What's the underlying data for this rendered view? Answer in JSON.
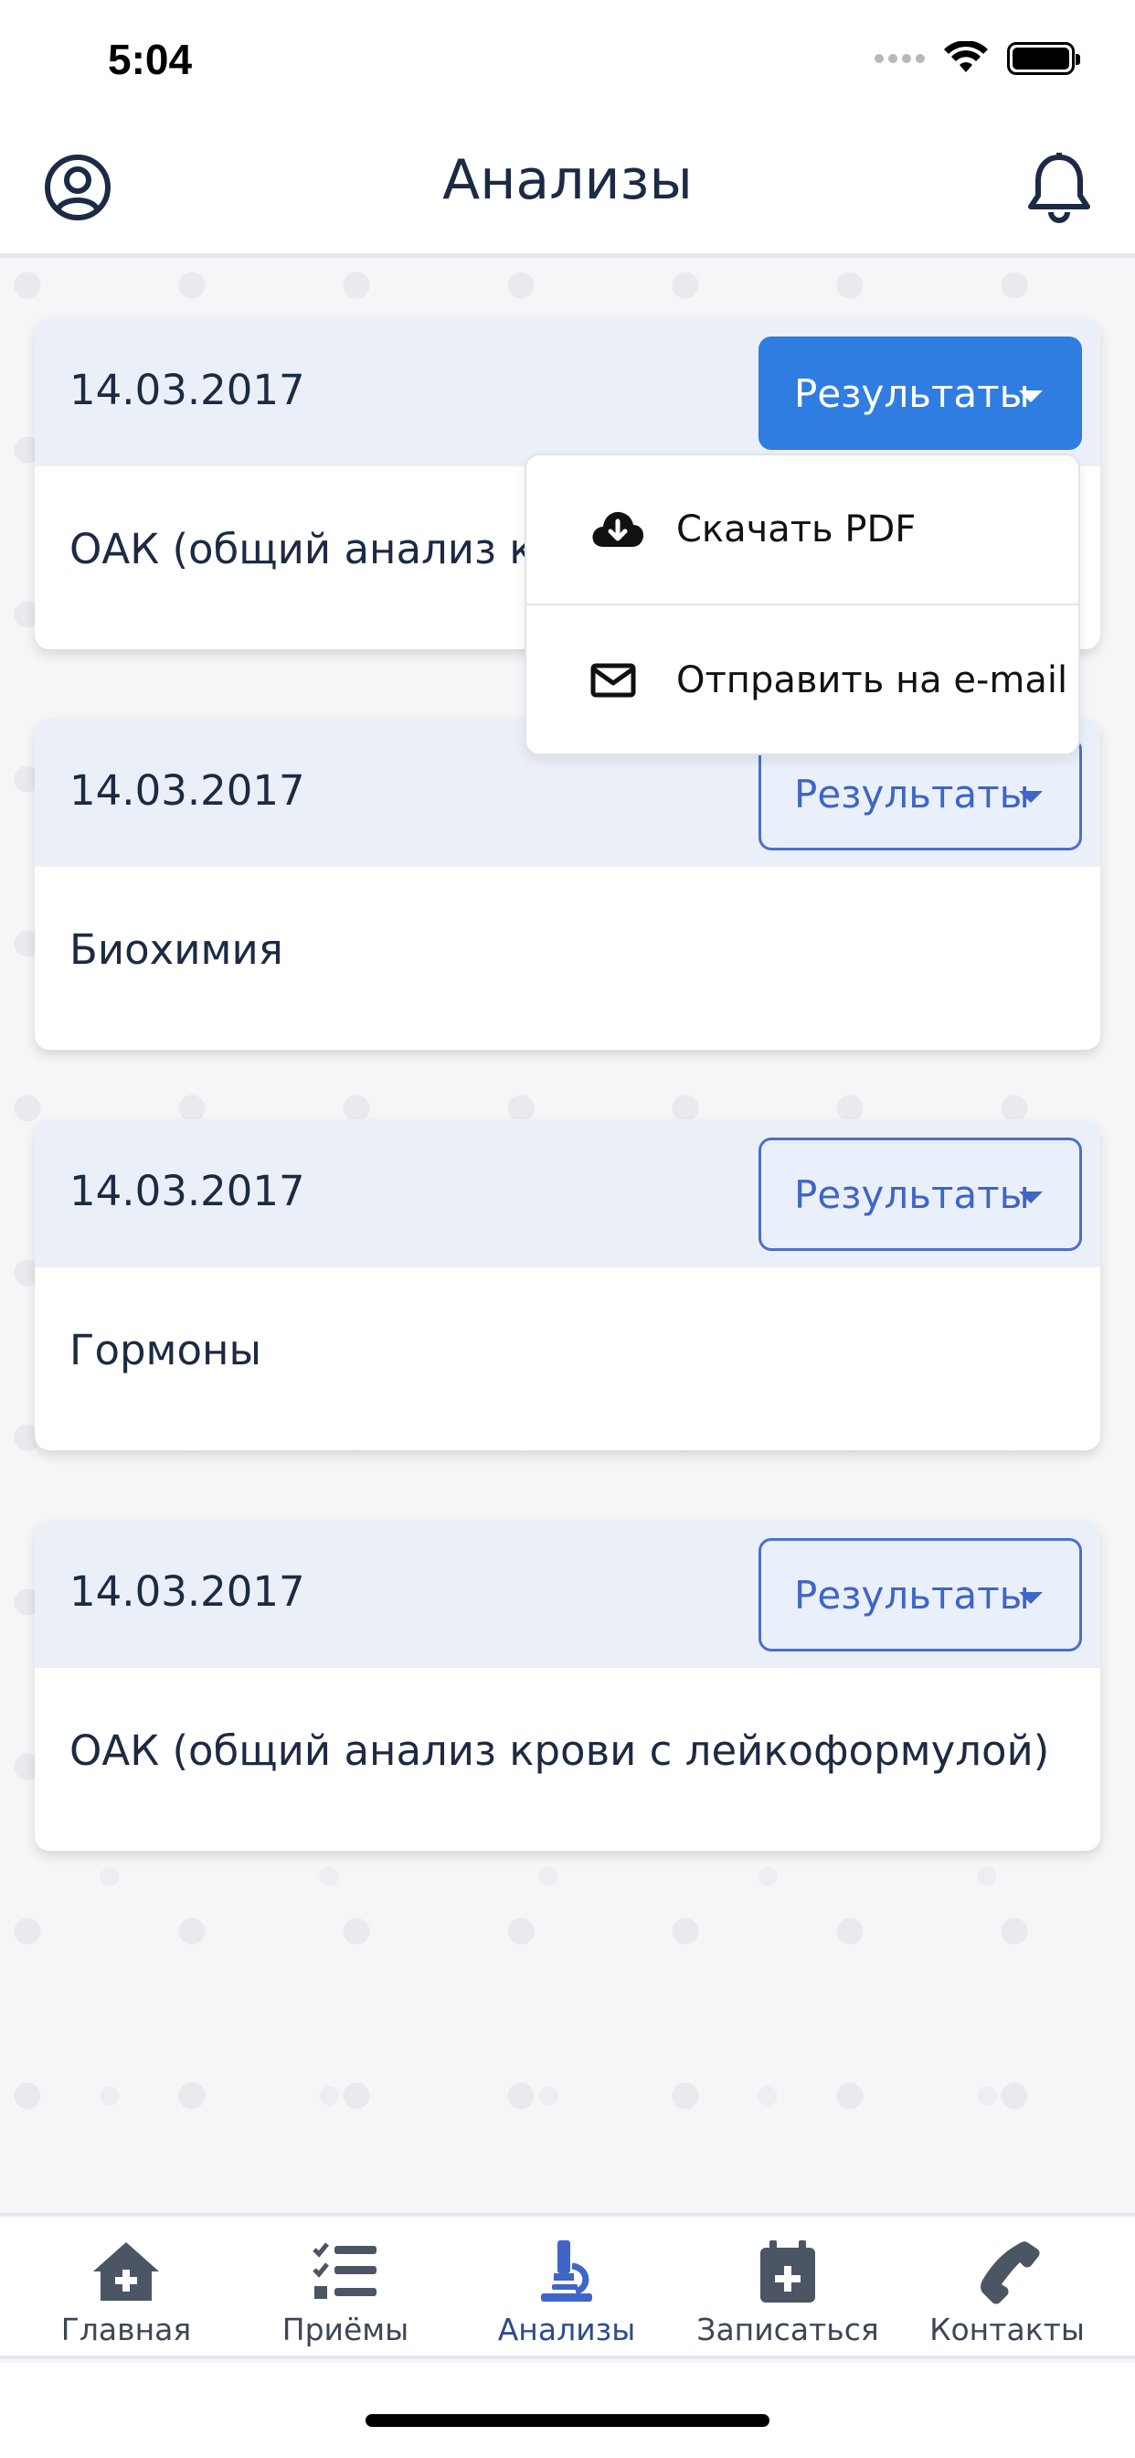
{
  "status_bar": {
    "time": "5:04"
  },
  "header": {
    "title": "Анализы",
    "profile_icon": "user-circle-icon",
    "bell_icon": "bell-icon"
  },
  "cards": [
    {
      "date": "14.03.2017",
      "button_label": "Результаты",
      "title": "ОАК (общий анализ крови с лейкоформулой)",
      "dropdown_open": true
    },
    {
      "date": "14.03.2017",
      "button_label": "Результаты",
      "title": "Биохимия",
      "dropdown_open": false
    },
    {
      "date": "14.03.2017",
      "button_label": "Результаты",
      "title": "Гормоны",
      "dropdown_open": false
    },
    {
      "date": "14.03.2017",
      "button_label": "Результаты",
      "title": "ОАК (общий анализ крови с лейкоформулой)",
      "dropdown_open": false
    }
  ],
  "dropdown": {
    "items": [
      {
        "label": "Скачать PDF",
        "icon": "cloud-download-icon"
      },
      {
        "label": "Отправить на e-mail",
        "icon": "envelope-icon"
      }
    ]
  },
  "tabbar": {
    "items": [
      {
        "label": "Главная",
        "icon": "home-plus-icon",
        "active": false
      },
      {
        "label": "Приёмы",
        "icon": "checklist-icon",
        "active": false
      },
      {
        "label": "Анализы",
        "icon": "microscope-icon",
        "active": true
      },
      {
        "label": "Записаться",
        "icon": "calendar-plus-icon",
        "active": false
      },
      {
        "label": "Контакты",
        "icon": "phone-icon",
        "active": false
      }
    ]
  },
  "colors": {
    "accent": "#2f7de1",
    "button_border": "#4a6fcf",
    "card_header_bg": "#ebf0f8",
    "text_dark": "#1c2a44",
    "active_tab_icon": "#3e65c8"
  }
}
